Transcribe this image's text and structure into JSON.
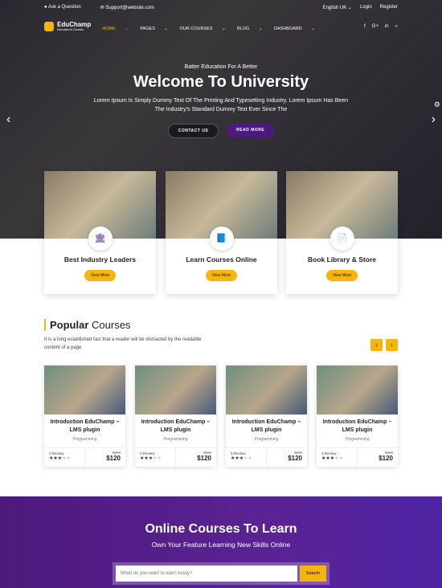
{
  "topbar": {
    "ask": "Ask a Question",
    "email": "Support@website.com",
    "language": "English UK",
    "login": "Login",
    "register": "Register"
  },
  "logo": {
    "name": "EduChamp",
    "tagline": "Education & Courses"
  },
  "nav": [
    "HOME",
    "PAGES",
    "OUR COURSES",
    "BLOG",
    "DASHBOARD"
  ],
  "social": [
    "f",
    "G+",
    "in"
  ],
  "hero": {
    "subtitle": "Batter Education For A Better",
    "title": "Welcome To University",
    "desc": "Lorem Ipsum Is Simply Dummy Text Of The Printing And Typesetting Industry. Lorem Ipsum Has Been The Industry's Standard Dummy Text Ever Since The",
    "contact": "CONTACT US",
    "read": "READ MORE"
  },
  "features": [
    {
      "title": "Best Industry Leaders",
      "icon": "🏛",
      "btn": "View More"
    },
    {
      "title": "Learn Courses Online",
      "icon": "📘",
      "btn": "View More"
    },
    {
      "title": "Book Library & Store",
      "icon": "📄",
      "btn": "View More"
    }
  ],
  "popular": {
    "title_bold": "Popular",
    "title_rest": " Courses",
    "desc": "It is a long established fact that a reader will be distracted by the readable content of a page"
  },
  "courses": [
    {
      "title": "Introduction EduChamp – LMS plugin",
      "category": "Programming",
      "reviews": "3 Review",
      "rating": 3,
      "old_price": "$190",
      "price": "$120"
    },
    {
      "title": "Introduction EduChamp – LMS plugin",
      "category": "Programming",
      "reviews": "3 Review",
      "rating": 3,
      "old_price": "$190",
      "price": "$120"
    },
    {
      "title": "Introduction EduChamp – LMS plugin",
      "category": "Programming",
      "reviews": "3 Review",
      "rating": 3,
      "old_price": "$190",
      "price": "$120"
    },
    {
      "title": "Introduction EduChamp – LMS plugin",
      "category": "Programming",
      "reviews": "3 Review",
      "rating": 3,
      "old_price": "$190",
      "price": "$120"
    }
  ],
  "banner": {
    "title": "Online Courses To Learn",
    "subtitle": "Own Your Feature Learning New Skills Online",
    "placeholder": "What do you want to learn today?",
    "search": "Search"
  },
  "colors": {
    "accent": "#f5b50c",
    "brand": "#4c1a7d"
  }
}
